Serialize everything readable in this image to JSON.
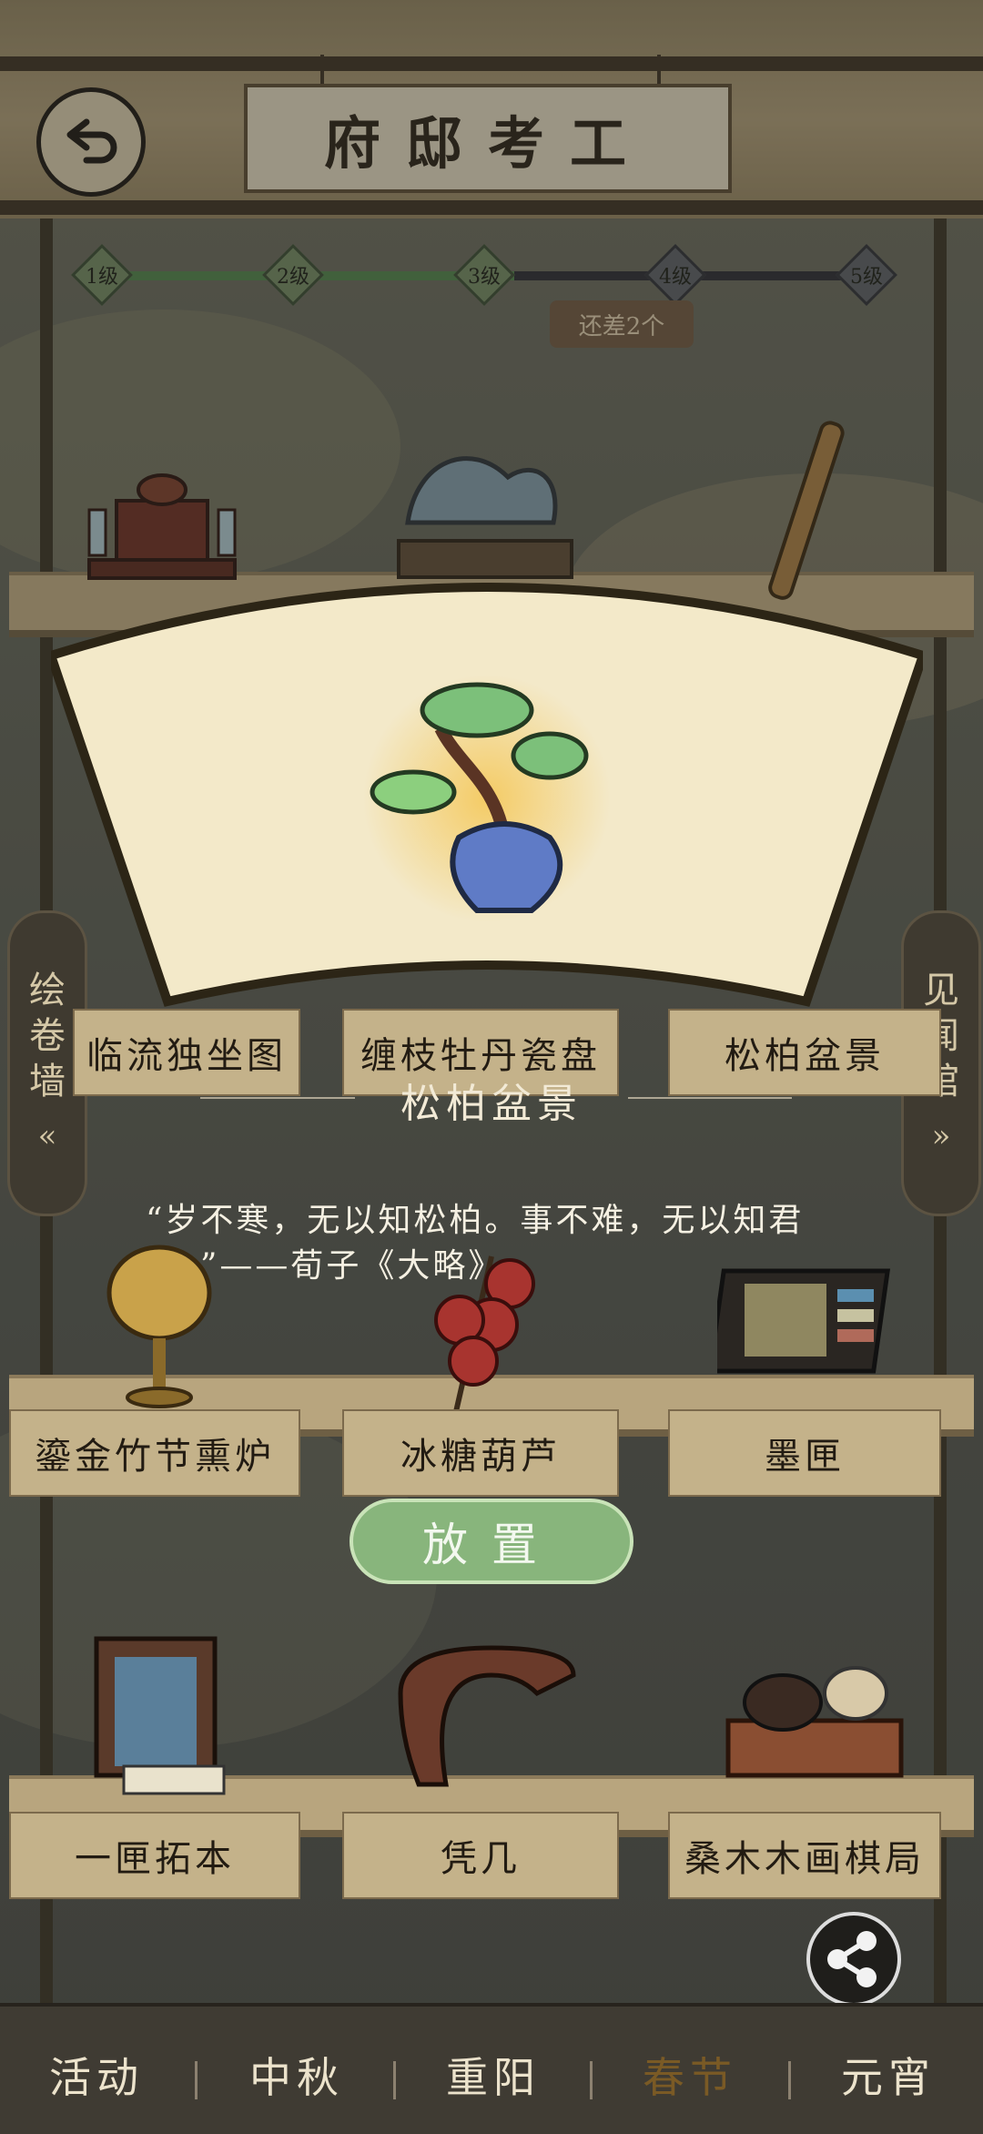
{
  "header": {
    "title": "府邸考工",
    "back_icon": "back-arrow-icon"
  },
  "progress": {
    "levels": [
      "1级",
      "2级",
      "3级",
      "4级",
      "5级"
    ],
    "current_level_index": 2,
    "remaining_badge": "还差2个"
  },
  "side_tabs": {
    "left": {
      "label_lines": [
        "绘",
        "卷",
        "墙"
      ],
      "chevron": "«"
    },
    "right": {
      "label_lines": [
        "见",
        "闻",
        "馆"
      ],
      "chevron": "»"
    }
  },
  "shelf_rows": [
    {
      "items": [
        {
          "label": "临流独坐图",
          "icon": "painting-scroll-icon"
        },
        {
          "label": "缠枝牡丹瓷盘",
          "icon": "porcelain-plate-icon"
        },
        {
          "label": "松柏盆景",
          "icon": "bonsai-icon"
        }
      ]
    },
    {
      "items": [
        {
          "label": "鎏金竹节熏炉",
          "icon": "incense-burner-icon"
        },
        {
          "label": "冰糖葫芦",
          "icon": "candied-haws-icon"
        },
        {
          "label": "墨匣",
          "icon": "ink-box-icon"
        }
      ]
    },
    {
      "items": [
        {
          "label": "一匣拓本",
          "icon": "rubbing-box-icon"
        },
        {
          "label": "凭几",
          "icon": "armrest-icon"
        },
        {
          "label": "桑木木画棋局",
          "icon": "chess-board-icon"
        }
      ]
    }
  ],
  "detail": {
    "name": "松柏盆景",
    "quote": "“岁不寒，无以知松柏。事不难，无以知君子。”——荀子《大略》",
    "place_button": "放置"
  },
  "share_icon": "share-icon",
  "bottom_nav": {
    "tabs": [
      "活动",
      "中秋",
      "重阳",
      "春节",
      "元宵"
    ],
    "active_index": 3
  }
}
